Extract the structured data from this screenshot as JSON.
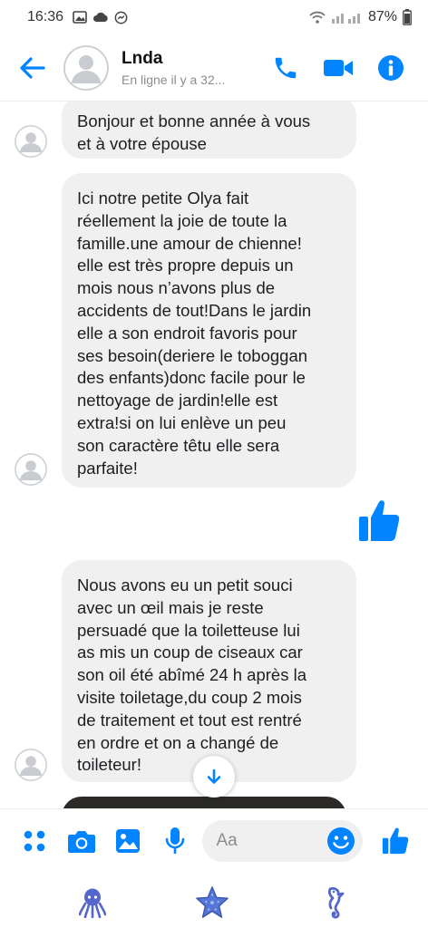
{
  "status_bar": {
    "time": "16:36",
    "battery": "87%",
    "icons": [
      "image-icon",
      "cloud-icon",
      "messenger-icon",
      "wifi-icon",
      "signal-icon",
      "battery-icon"
    ]
  },
  "header": {
    "contact_name": "Lnda",
    "contact_status": "En ligne il y a 32...",
    "accent_color": "#0084ff"
  },
  "messages": [
    {
      "type": "received-text",
      "text": "Bonjour et bonne année à vous\net à votre épouse"
    },
    {
      "type": "received-text",
      "text": "Ici notre petite Olya fait\nréellement la joie de toute la\nfamille.une amour de chienne!\nelle est très propre depuis un\nmois nous n’avons plus de\naccidents de tout!Dans le jardin\nelle a son endroit favoris pour\nses besoin(deriere le toboggan\ndes enfants)donc facile pour le\nnettoyage de jardin!elle est\nextra!si on lui enlève un peu\nson caractère têtu elle sera\nparfaite!"
    },
    {
      "type": "sent-like",
      "icon": "thumbs-up-icon"
    },
    {
      "type": "received-text",
      "text": "Nous avons eu un petit souci\navec un œil mais je reste\npersuadé que la toiletteuse lui\nas mis un coup de ciseaux car\nson oil été abîmé 24 h après la\nvisite toiletage,du coup 2 mois\nde traitement et tout est rentré\nen ordre et on a changé de\ntoileteur!"
    },
    {
      "type": "received-image"
    }
  ],
  "composer": {
    "placeholder": "Aa"
  },
  "bottom_nav": {
    "items": [
      "octopus-icon",
      "starfish-icon",
      "seahorse-icon"
    ]
  }
}
